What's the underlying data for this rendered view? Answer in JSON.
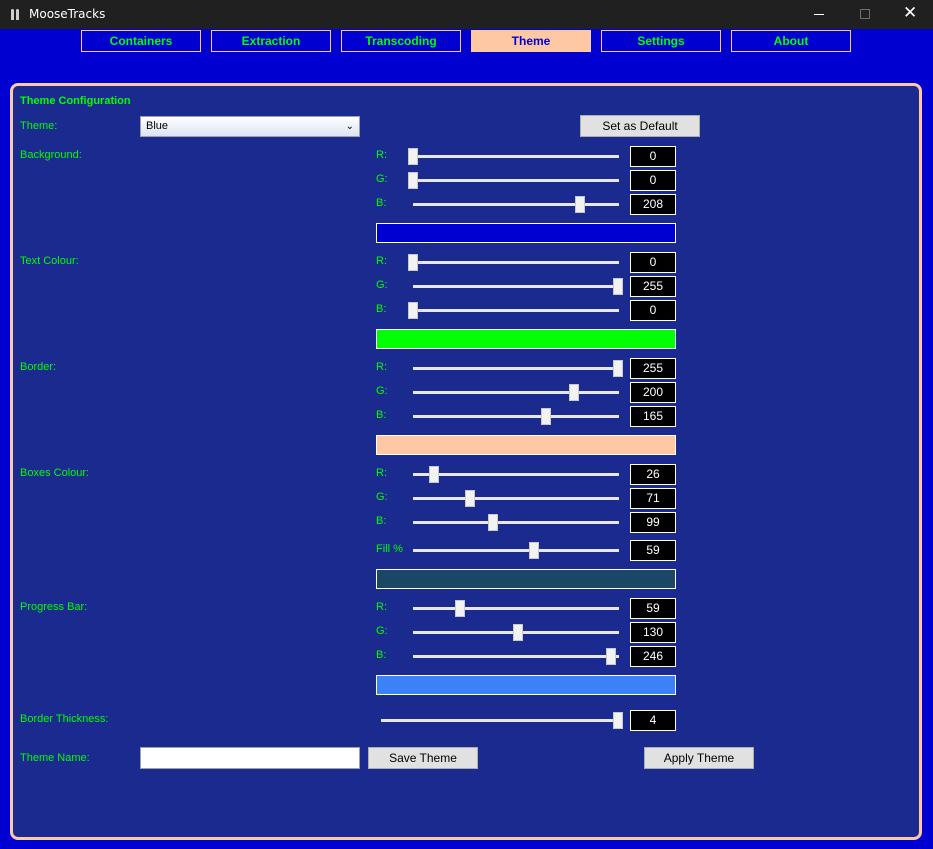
{
  "window": {
    "title": "MooseTracks",
    "minimize_glyph": "",
    "close_glyph": "✕"
  },
  "tabs": [
    {
      "label": "Containers",
      "active": false
    },
    {
      "label": "Extraction",
      "active": false
    },
    {
      "label": "Transcoding",
      "active": false
    },
    {
      "label": "Theme",
      "active": true
    },
    {
      "label": "Settings",
      "active": false
    },
    {
      "label": "About",
      "active": false
    }
  ],
  "colors": {
    "background": "#0000d0",
    "text": "#00ff00",
    "border": "#ffc8a5",
    "panel": "#1a2a8f",
    "boxes": "#1a4763",
    "progress": "#3b82f6"
  },
  "theme": {
    "section_title": "Theme Configuration",
    "theme_label": "Theme:",
    "theme_value": "Blue",
    "dropdown_chevron": "⌄",
    "set_default_label": "Set as Default",
    "groups": [
      {
        "label": "Background:",
        "swatch_color": "#0000d0",
        "channels": [
          {
            "name": "R:",
            "value": "0",
            "fraction": 0.0
          },
          {
            "name": "G:",
            "value": "0",
            "fraction": 0.0
          },
          {
            "name": "B:",
            "value": "208",
            "fraction": 0.8157
          }
        ]
      },
      {
        "label": "Text Colour:",
        "swatch_color": "#00ff00",
        "channels": [
          {
            "name": "R:",
            "value": "0",
            "fraction": 0.0
          },
          {
            "name": "G:",
            "value": "255",
            "fraction": 1.0
          },
          {
            "name": "B:",
            "value": "0",
            "fraction": 0.0
          }
        ]
      },
      {
        "label": "Border:",
        "swatch_color": "#ffc8a5",
        "channels": [
          {
            "name": "R:",
            "value": "255",
            "fraction": 1.0
          },
          {
            "name": "G:",
            "value": "200",
            "fraction": 0.7843
          },
          {
            "name": "B:",
            "value": "165",
            "fraction": 0.6471
          }
        ]
      },
      {
        "label": "Boxes Colour:",
        "swatch_color": "#1a4763",
        "channels": [
          {
            "name": "R:",
            "value": "26",
            "fraction": 0.102
          },
          {
            "name": "G:",
            "value": "71",
            "fraction": 0.2784
          },
          {
            "name": "B:",
            "value": "99",
            "fraction": 0.3882
          },
          {
            "name": "Fill %",
            "value": "59",
            "fraction": 0.59
          }
        ]
      },
      {
        "label": "Progress Bar:",
        "swatch_color": "#3b82f6",
        "channels": [
          {
            "name": "R:",
            "value": "59",
            "fraction": 0.2314
          },
          {
            "name": "G:",
            "value": "130",
            "fraction": 0.5098
          },
          {
            "name": "B:",
            "value": "246",
            "fraction": 0.9647
          }
        ]
      }
    ],
    "border_thickness": {
      "label": "Border Thickness:",
      "value": "4",
      "fraction": 1.0
    },
    "theme_name_label": "Theme Name:",
    "theme_name_value": "",
    "save_label": "Save Theme",
    "apply_label": "Apply Theme"
  }
}
